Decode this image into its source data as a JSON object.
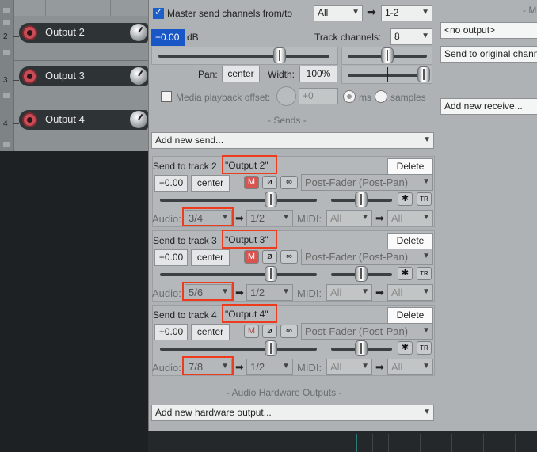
{
  "tracks": [
    {
      "num": "2",
      "name": "Output 2"
    },
    {
      "num": "3",
      "name": "Output 3"
    },
    {
      "num": "4",
      "name": "Output 4"
    }
  ],
  "master": {
    "label": "Master send channels from/to",
    "from": "All",
    "to": "1-2"
  },
  "volume": {
    "value": "+0.00",
    "unit": "dB"
  },
  "track_channels": {
    "label": "Track channels:",
    "value": "8"
  },
  "pan": {
    "label": "Pan:",
    "value": "center",
    "width_label": "Width:",
    "width_value": "100%"
  },
  "media_offset": {
    "label": "Media playback offset:",
    "value": "+0",
    "ms": "ms",
    "samples": "samples"
  },
  "sends_header": "-  Sends  -",
  "add_send": "Add new send...",
  "sends": [
    {
      "title": "Send to track 2",
      "name": "\"Output 2\"",
      "delete": "Delete",
      "vol": "+0.00",
      "pan": "center",
      "mode": "Post-Fader (Post-Pan)",
      "audio_label": "Audio:",
      "audio_src": "3/4",
      "audio_dst": "1/2",
      "midi_label": "MIDI:",
      "midi_src": "All",
      "midi_dst": "All"
    },
    {
      "title": "Send to track 3",
      "name": "\"Output 3\"",
      "delete": "Delete",
      "vol": "+0.00",
      "pan": "center",
      "mode": "Post-Fader (Post-Pan)",
      "audio_label": "Audio:",
      "audio_src": "5/6",
      "audio_dst": "1/2",
      "midi_label": "MIDI:",
      "midi_src": "All",
      "midi_dst": "All"
    },
    {
      "title": "Send to track 4",
      "name": "\"Output 4\"",
      "delete": "Delete",
      "vol": "+0.00",
      "pan": "center",
      "mode": "Post-Fader (Post-Pan)",
      "audio_label": "Audio:",
      "audio_src": "7/8",
      "audio_dst": "1/2",
      "midi_label": "MIDI:",
      "midi_src": "All",
      "midi_dst": "All"
    }
  ],
  "hw_header": "-  Audio Hardware Outputs  -",
  "add_hw": "Add new hardware output...",
  "right": {
    "header": "- M",
    "no_output": "<no output>",
    "send_original": "Send to original channels",
    "add_receive": "Add new receive..."
  },
  "icons": {
    "arrow": "right-arrow-icon",
    "mute": "mute-icon",
    "phase": "phase-invert-icon",
    "mono": "mono-stereo-icon",
    "env": "envelope-icon",
    "route": "midi-route-icon"
  },
  "colors": {
    "highlight": "#ee3b1e",
    "check": "#1c5fc8",
    "mute_active": "#c74a4a"
  }
}
